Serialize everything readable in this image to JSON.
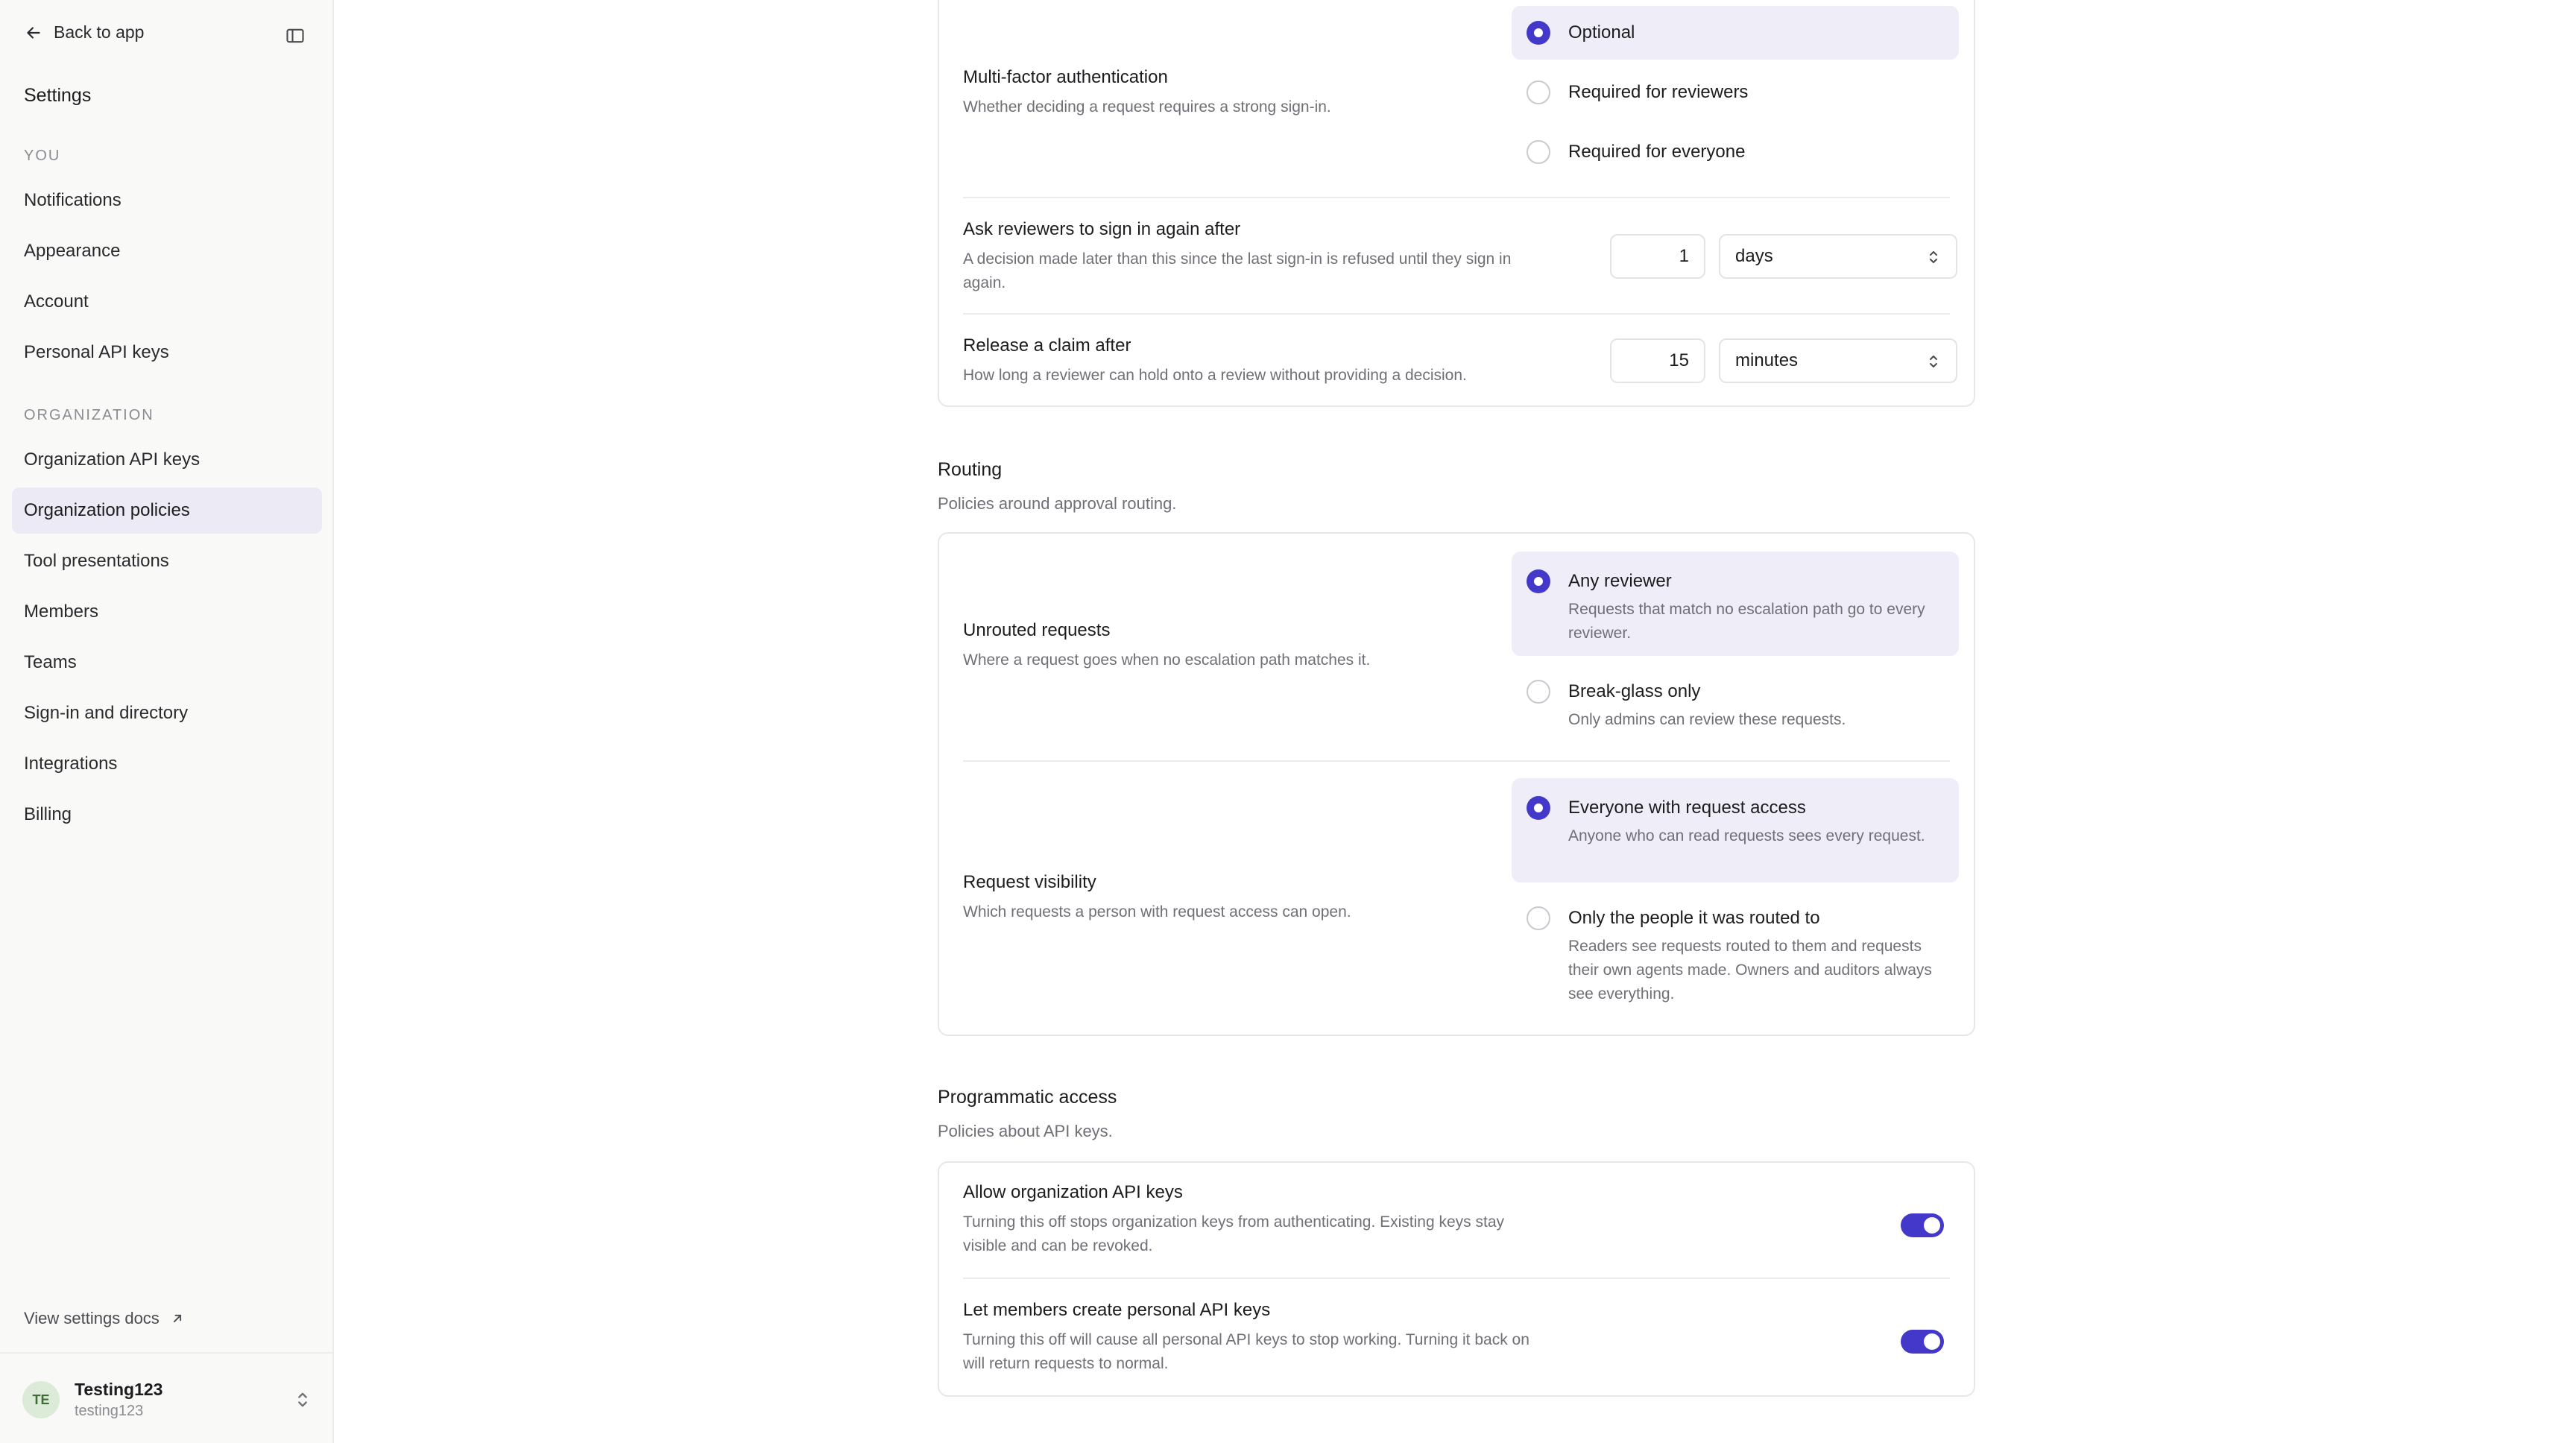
{
  "sidebar": {
    "back_label": "Back to app",
    "title": "Settings",
    "you_label": "YOU",
    "you_items": [
      {
        "label": "Notifications"
      },
      {
        "label": "Appearance"
      },
      {
        "label": "Account"
      },
      {
        "label": "Personal API keys"
      }
    ],
    "org_label": "ORGANIZATION",
    "org_items": [
      {
        "label": "Organization API keys"
      },
      {
        "label": "Organization policies"
      },
      {
        "label": "Tool presentations"
      },
      {
        "label": "Members"
      },
      {
        "label": "Teams"
      },
      {
        "label": "Sign-in and directory"
      },
      {
        "label": "Integrations"
      },
      {
        "label": "Billing"
      }
    ],
    "active_item": "Organization policies",
    "docs_label": "View settings docs",
    "user": {
      "initials": "TE",
      "name": "Testing123",
      "handle": "testing123"
    }
  },
  "auth": {
    "mfa": {
      "label": "Multi-factor authentication",
      "desc": "Whether deciding a request requires a strong sign-in.",
      "options": [
        {
          "label": "Optional",
          "selected": true
        },
        {
          "label": "Required for reviewers",
          "selected": false
        },
        {
          "label": "Required for everyone",
          "selected": false
        }
      ]
    },
    "reauth": {
      "label": "Ask reviewers to sign in again after",
      "desc": "A decision made later than this since the last sign-in is refused until they sign in again.",
      "value": "1",
      "unit": "days"
    },
    "claim": {
      "label": "Release a claim after",
      "desc": "How long a reviewer can hold onto a review without providing a decision.",
      "value": "15",
      "unit": "minutes"
    }
  },
  "routing": {
    "title": "Routing",
    "desc": "Policies around approval routing.",
    "unrouted": {
      "label": "Unrouted requests",
      "desc": "Where a request goes when no escalation path matches it.",
      "options": [
        {
          "label": "Any reviewer",
          "desc": "Requests that match no escalation path go to every reviewer.",
          "selected": true
        },
        {
          "label": "Break-glass only",
          "desc": "Only admins can review these requests.",
          "selected": false
        }
      ]
    },
    "visibility": {
      "label": "Request visibility",
      "desc": "Which requests a person with request access can open.",
      "options": [
        {
          "label": "Everyone with request access",
          "desc": "Anyone who can read requests sees every request.",
          "selected": true
        },
        {
          "label": "Only the people it was routed to",
          "desc": "Readers see requests routed to them and requests their own agents made. Owners and auditors always see everything.",
          "selected": false
        }
      ]
    }
  },
  "programmatic": {
    "title": "Programmatic access",
    "desc": "Policies about API keys.",
    "org_keys": {
      "label": "Allow organization API keys",
      "desc": "Turning this off stops organization keys from authenticating. Existing keys stay visible and can be revoked.",
      "enabled": true
    },
    "personal_keys": {
      "label": "Let members create personal API keys",
      "desc": "Turning this off will cause all personal API keys to stop working. Turning it back on will return requests to normal.",
      "enabled": true
    }
  },
  "colors": {
    "accent": "#4338ca",
    "selected_bg": "#efeef8",
    "sidebar_bg": "#f9f9f8"
  }
}
